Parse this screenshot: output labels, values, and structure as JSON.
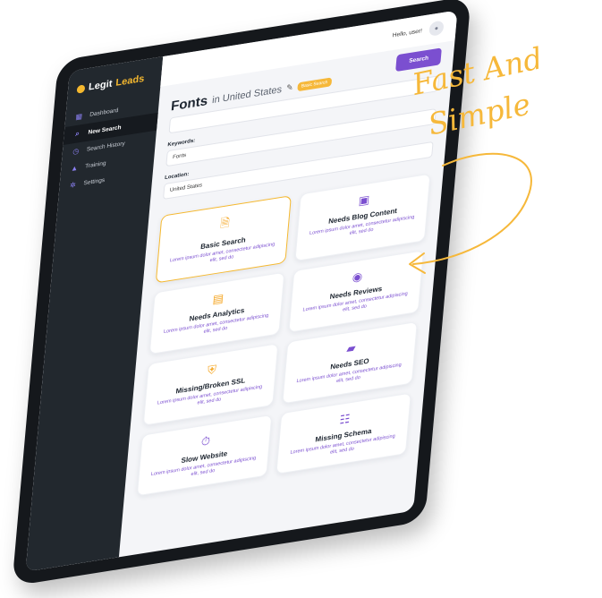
{
  "brand": {
    "name_part1": "Legit",
    "name_part2": "Leads"
  },
  "sidebar": {
    "items": [
      {
        "label": "Dashboard",
        "icon": "grid-icon",
        "active": false
      },
      {
        "label": "New Search",
        "icon": "search-icon",
        "active": true
      },
      {
        "label": "Search History",
        "icon": "history-icon",
        "active": false
      },
      {
        "label": "Training",
        "icon": "graduation-cap-icon",
        "active": false
      },
      {
        "label": "Settings",
        "icon": "gear-icon",
        "active": false
      }
    ]
  },
  "header": {
    "greeting": "Hello, user!",
    "avatar_icon": "user-icon"
  },
  "search": {
    "button_label": "Search",
    "title": "Fonts",
    "title_location": "in United States",
    "badge": "Basic Search",
    "keywords_label": "Keywords:",
    "keywords_value": "Fonts",
    "location_label": "Location:",
    "location_value": "United States"
  },
  "cards": [
    {
      "title": "Basic Search",
      "desc": "Lorem ipsum dolor amet, consectetur adipiscing elit, sed do",
      "icon": "document-search-icon",
      "selected": true
    },
    {
      "title": "Needs Blog Content",
      "desc": "Lorem ipsum dolor amet, consectetur adipiscing elit, sed do",
      "icon": "image-document-icon",
      "selected": false
    },
    {
      "title": "Needs Analytics",
      "desc": "Lorem ipsum dolor amet, consectetur adipiscing elit, sed do",
      "icon": "analytics-window-icon",
      "selected": false
    },
    {
      "title": "Needs Reviews",
      "desc": "Lorem ipsum dolor amet, consectetur adipiscing elit, sed do",
      "icon": "eye-icon",
      "selected": false
    },
    {
      "title": "Missing/Broken SSL",
      "desc": "Lorem ipsum dolor amet, consectetur adipiscing elit, sed do",
      "icon": "shield-icon",
      "selected": false
    },
    {
      "title": "Needs SEO",
      "desc": "Lorem ipsum dolor amet, consectetur adipiscing elit, sed do",
      "icon": "folder-chart-icon",
      "selected": false
    },
    {
      "title": "Slow Website",
      "desc": "Lorem ipsum dolor amet, consectetur adipiscing elit, sed do",
      "icon": "stopwatch-icon",
      "selected": false
    },
    {
      "title": "Missing Schema",
      "desc": "Lorem ipsum dolor amet, consectetur adipiscing elit, sed do",
      "icon": "schema-icon",
      "selected": false
    }
  ],
  "annotation": {
    "line1": "Fast And",
    "line2": "Simple"
  },
  "colors": {
    "accent": "#7b4fd0",
    "highlight": "#f6b83a",
    "sidebar_bg": "#22282e"
  }
}
